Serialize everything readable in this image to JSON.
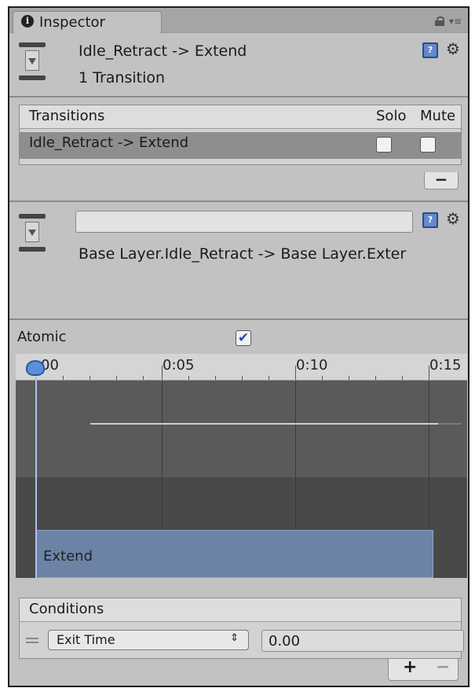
{
  "tab": {
    "title": "Inspector"
  },
  "header": {
    "title": "Idle_Retract -> Extend",
    "subtitle": "1 Transition"
  },
  "transitions": {
    "header": "Transitions",
    "solo_label": "Solo",
    "mute_label": "Mute",
    "rows": [
      {
        "label": "Idle_Retract -> Extend",
        "solo": false,
        "mute": false
      }
    ],
    "remove_label": "−"
  },
  "transition_detail": {
    "name_value": "",
    "path": "Base Layer.Idle_Retract -> Base Layer.Exter"
  },
  "atomic": {
    "label": "Atomic",
    "checked": true,
    "check_glyph": "✔"
  },
  "timeline": {
    "ticks": [
      "0:00",
      "0:05",
      "0:10",
      "0:15"
    ],
    "clip_label": "Extend",
    "playhead_label": "00"
  },
  "conditions": {
    "header": "Conditions",
    "rows": [
      {
        "parameter": "Exit Time",
        "value": "0.00"
      }
    ],
    "add_label": "+",
    "remove_label": "−"
  },
  "icons": {
    "help": "?",
    "gear": "⚙",
    "dropdown_arrow": "⇕",
    "info": "i",
    "menu": "▾≡"
  },
  "colors": {
    "clip": "#6d83a6",
    "playhead": "#5d8fd8"
  }
}
